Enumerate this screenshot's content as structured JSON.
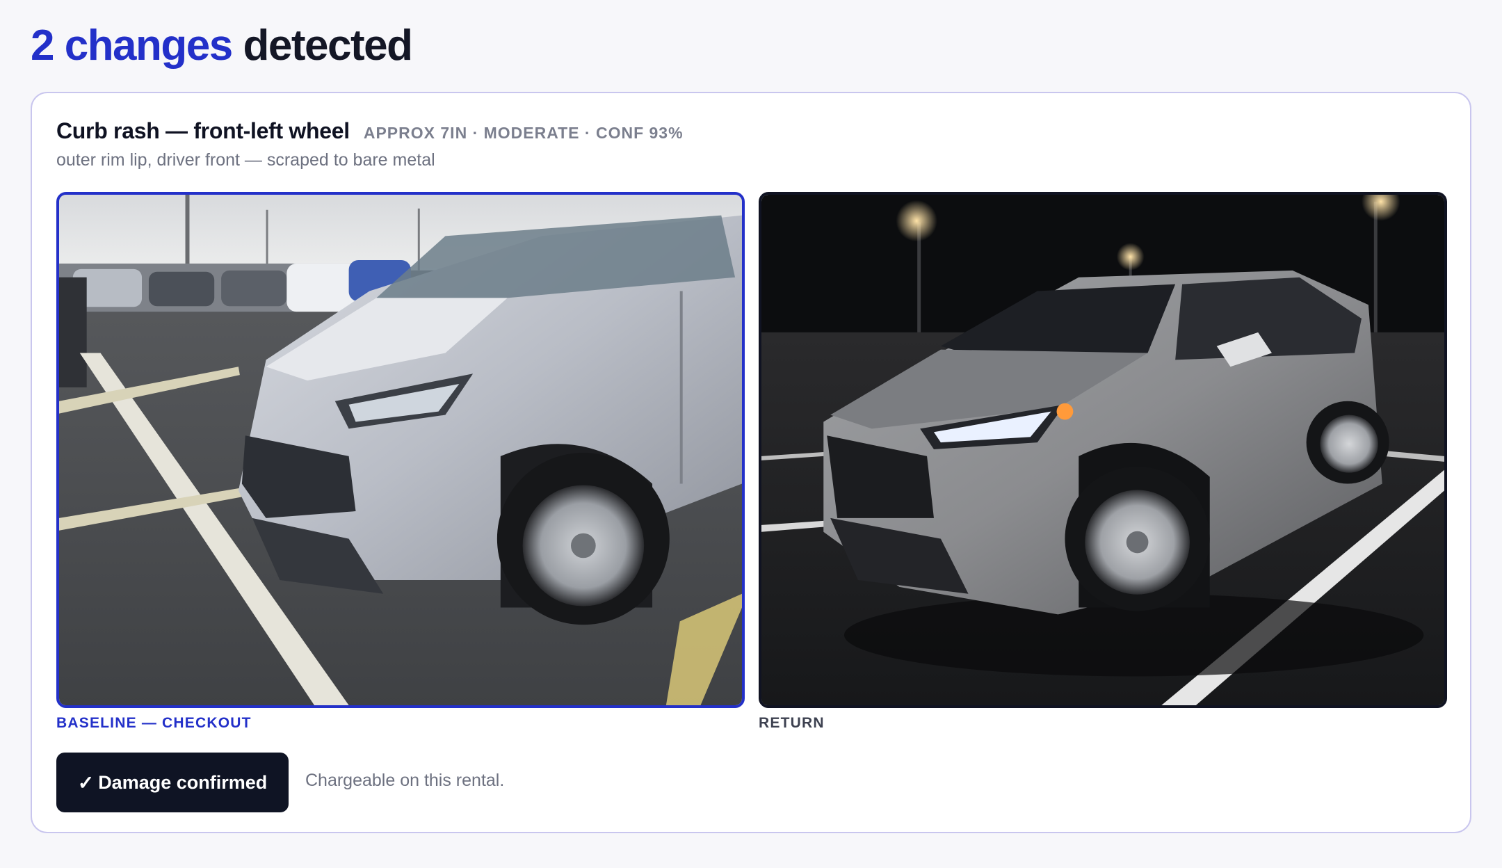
{
  "headline": {
    "count_text": "2 changes",
    "rest_text": " detected"
  },
  "finding": {
    "title": "Curb rash — front-left wheel",
    "meta": "APPROX 7IN · MODERATE · CONF 93%",
    "description": "outer rim lip, driver front — scraped to bare metal",
    "baseline_caption": "BASELINE — CHECKOUT",
    "return_caption": "RETURN",
    "confirm_button_label": "Damage confirmed",
    "confirm_icon": "check-icon",
    "confirm_note": "Chargeable on this rental."
  },
  "colors": {
    "accent": "#2330c9",
    "button_bg": "#0f1424",
    "card_border": "#c9c6ee"
  }
}
